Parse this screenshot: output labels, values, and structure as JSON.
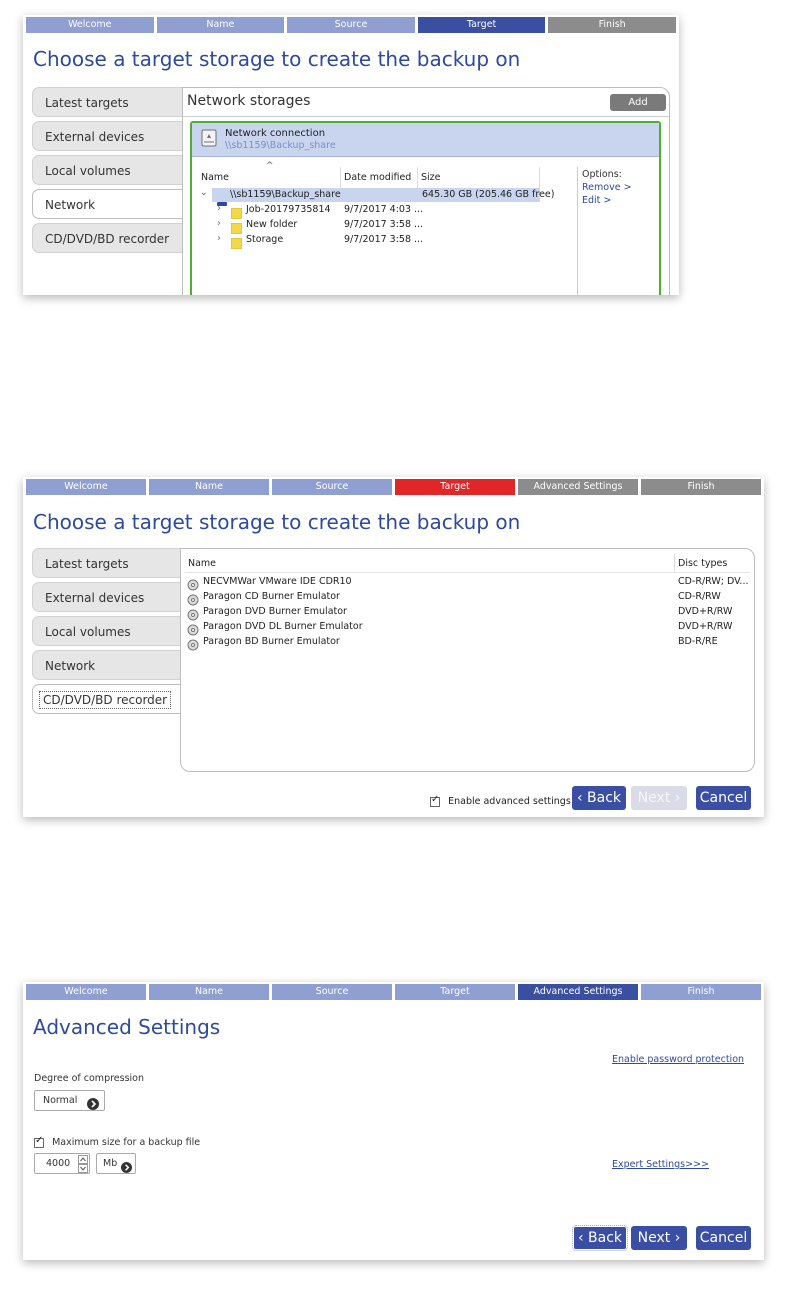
{
  "panel1": {
    "steps": [
      "Welcome",
      "Name",
      "Source",
      "Target",
      "Finish"
    ],
    "title": "Choose a target storage to create the backup on",
    "tabs": [
      "Latest targets",
      "External devices",
      "Local volumes",
      "Network",
      "CD/DVD/BD recorder"
    ],
    "storages_title": "Network storages",
    "add_label": "Add",
    "connection": {
      "name": "Network connection",
      "path": "\\\\sb1159\\Backup_share"
    },
    "columns": [
      "Name",
      "Date modified",
      "Size"
    ],
    "share_row": {
      "name": "\\\\sb1159\\Backup_share",
      "size": "645.30 GB (205.46 GB free)"
    },
    "rows": [
      {
        "name": "Job-20179735814",
        "date": "9/7/2017 4:03 ..."
      },
      {
        "name": "New folder",
        "date": "9/7/2017 3:58 ..."
      },
      {
        "name": "Storage",
        "date": "9/7/2017 3:58 ..."
      }
    ],
    "options": {
      "label": "Options:",
      "remove": "Remove >",
      "edit": "Edit >"
    }
  },
  "panel2": {
    "steps": [
      "Welcome",
      "Name",
      "Source",
      "Target",
      "Advanced Settings",
      "Finish"
    ],
    "title": "Choose a target storage to create the backup on",
    "tabs": [
      "Latest targets",
      "External devices",
      "Local volumes",
      "Network",
      "CD/DVD/BD recorder"
    ],
    "columns": [
      "Name",
      "Disc types"
    ],
    "drives": [
      {
        "name": "NECVMWar VMware IDE CDR10",
        "types": "CD-R/RW; DV..."
      },
      {
        "name": "Paragon CD Burner Emulator",
        "types": "CD-R/RW"
      },
      {
        "name": "Paragon DVD Burner Emulator",
        "types": "DVD+R/RW"
      },
      {
        "name": "Paragon DVD DL Burner Emulator",
        "types": "DVD+R/RW"
      },
      {
        "name": "Paragon BD Burner Emulator",
        "types": "BD-R/RE"
      }
    ],
    "advanced_checkbox": "Enable advanced settings",
    "back": "‹ Back",
    "next": "Next ›",
    "cancel": "Cancel"
  },
  "panel3": {
    "steps": [
      "Welcome",
      "Name",
      "Source",
      "Target",
      "Advanced Settings",
      "Finish"
    ],
    "title": "Advanced Settings",
    "password_link": "Enable password protection",
    "compression_label": "Degree of compression",
    "compression_value": "Normal",
    "maxsize_label": "Maximum size for a backup file",
    "maxsize_value": "4000",
    "unit_value": "Mb",
    "expert_link": "Expert Settings>>>",
    "back": "‹ Back",
    "next": "Next ›",
    "cancel": "Cancel"
  },
  "colors": {
    "step_default": "#8f9fd2",
    "step_current": "#3a4f9f",
    "step_grey": "#8c8c8c",
    "step_error": "#e02626",
    "title": "#2e4a9e",
    "selection": "#c9d4ef",
    "storage_border": "#4caf32"
  },
  "icons": [
    "network-drive-icon",
    "drive-icon",
    "folder-icon",
    "cd-drive-icon",
    "chevron-right-icon",
    "chevron-down-icon",
    "spinner-arrows-icon"
  ]
}
